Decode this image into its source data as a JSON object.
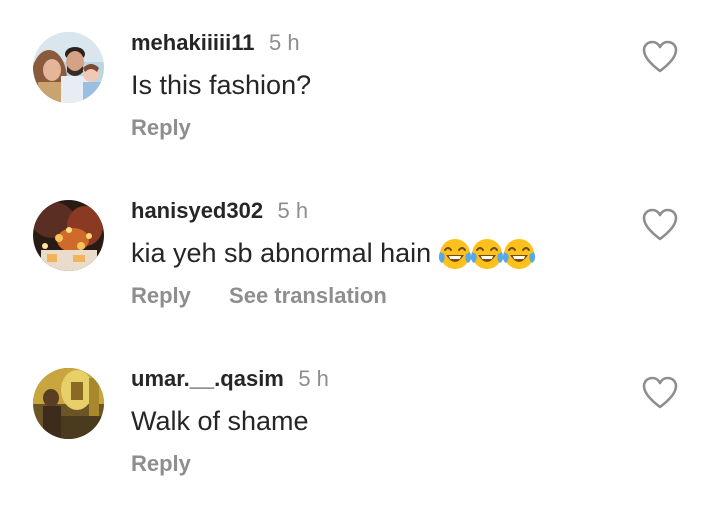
{
  "comments": [
    {
      "username": "mehakiiiii11",
      "time": "5 h",
      "text": "Is this fashion?",
      "emojis": [],
      "actions": {
        "reply": "Reply"
      },
      "avatar_icon": "profile-photo-family"
    },
    {
      "username": "hanisyed302",
      "time": "5 h",
      "text": "kia yeh sb abnormal hain",
      "emojis": [
        "face-with-tears-of-joy",
        "face-with-tears-of-joy",
        "face-with-tears-of-joy"
      ],
      "actions": {
        "reply": "Reply",
        "translate": "See translation"
      },
      "avatar_icon": "profile-photo-candles"
    },
    {
      "username": "umar.__.qasim",
      "time": "5 h",
      "text": "Walk of shame",
      "emojis": [],
      "actions": {
        "reply": "Reply"
      },
      "avatar_icon": "profile-photo-portrait"
    }
  ],
  "colors": {
    "primary_text": "#262626",
    "secondary_text": "#8e8e8e",
    "heart_outline": "#8e8e8e",
    "background": "#ffffff"
  },
  "icons": {
    "like": "heart-outline-icon",
    "emoji": "face-with-tears-of-joy"
  }
}
